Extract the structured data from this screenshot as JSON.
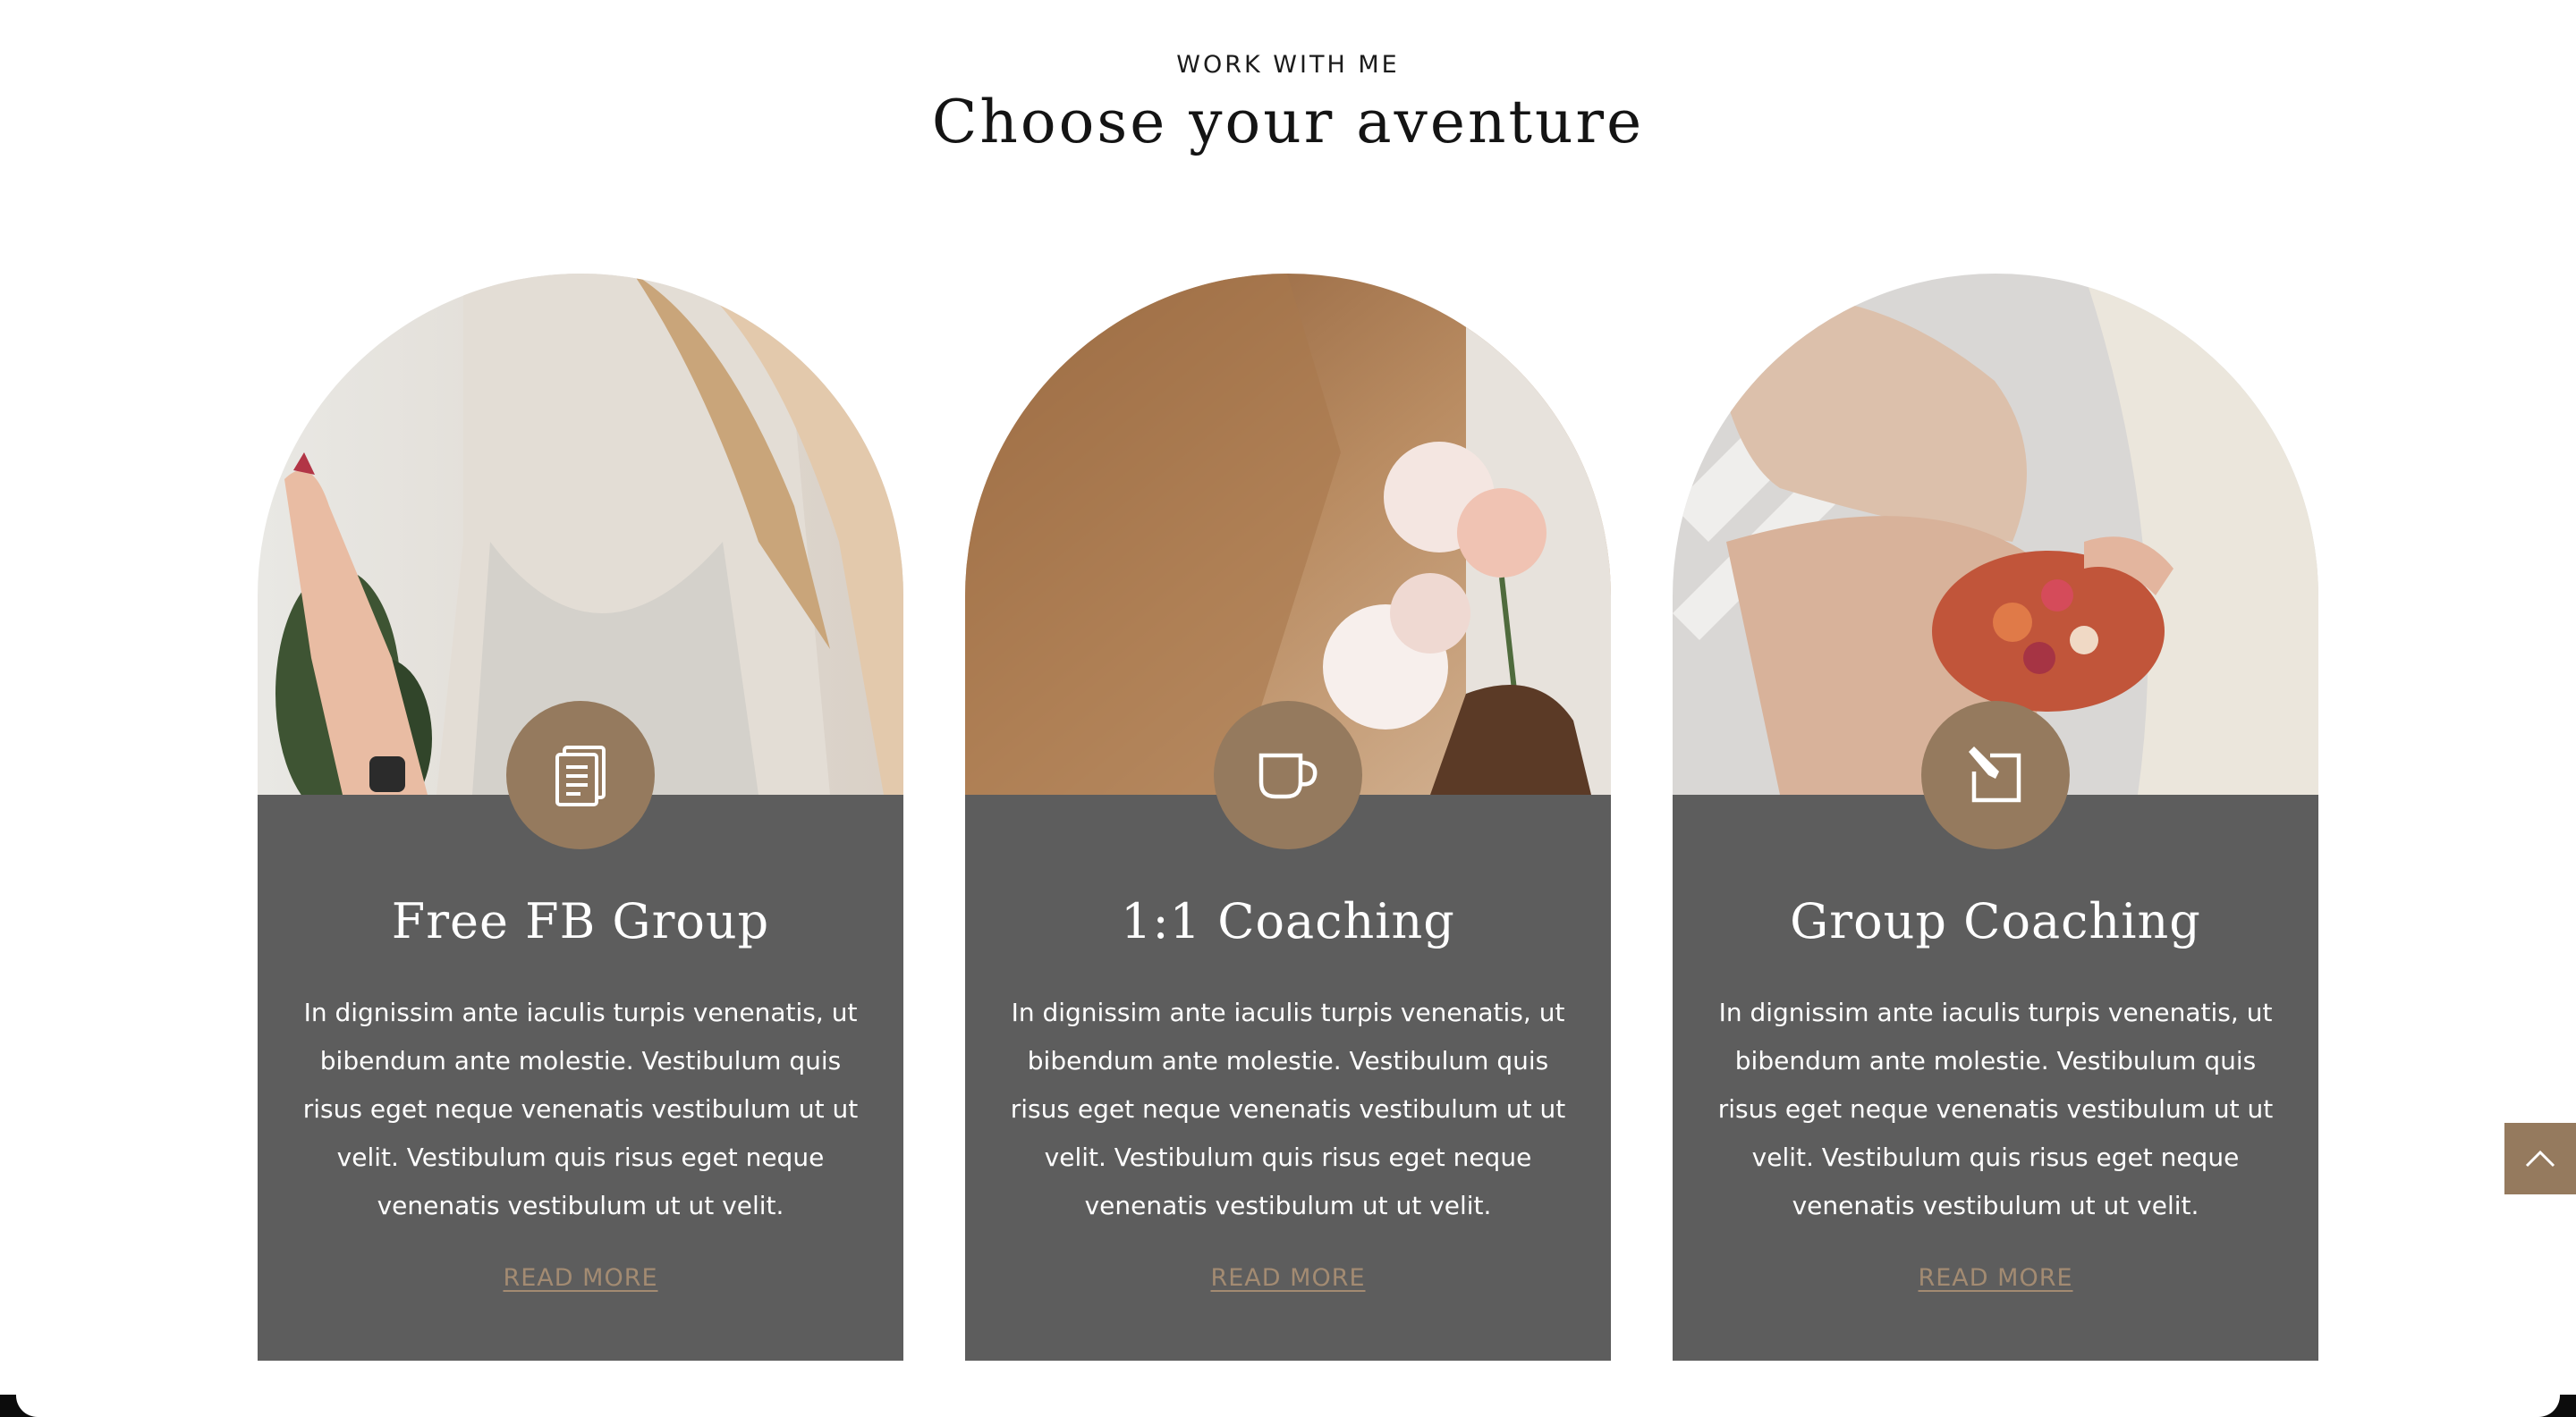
{
  "section": {
    "eyebrow": "WORK WITH ME",
    "title": "Choose your aventure"
  },
  "cards": [
    {
      "title": "Free FB Group",
      "text": "In dignissim ante iaculis turpis venenatis, ut bibendum ante molestie. Vestibulum quis risus eget neque venenatis vestibulum ut ut velit. Vestibulum quis risus eget neque venenatis vestibulum ut ut velit.",
      "link": "READ MORE",
      "icon": "document-icon",
      "photo": "woman-praying-hands-photo"
    },
    {
      "title": "1:1 Coaching",
      "text": "In dignissim ante iaculis turpis venenatis, ut bibendum ante molestie. Vestibulum quis risus eget neque venenatis vestibulum ut ut velit. Vestibulum quis risus eget neque venenatis vestibulum ut ut velit.",
      "link": "READ MORE",
      "icon": "coffee-cup-icon",
      "photo": "woman-holding-flowers-photo"
    },
    {
      "title": "Group Coaching",
      "text": "In dignissim ante iaculis turpis venenatis, ut bibendum ante molestie. Vestibulum quis risus eget neque venenatis vestibulum ut ut velit. Vestibulum quis risus eget neque venenatis vestibulum ut ut velit.",
      "link": "READ MORE",
      "icon": "edit-note-icon",
      "photo": "woman-holding-fruit-plate-photo"
    }
  ],
  "back_to_top": {
    "icon": "chevron-up-icon"
  },
  "colors": {
    "accent": "#957a5e",
    "card_body": "#5d5d5d",
    "link": "#a38b72",
    "heading": "#141414"
  }
}
